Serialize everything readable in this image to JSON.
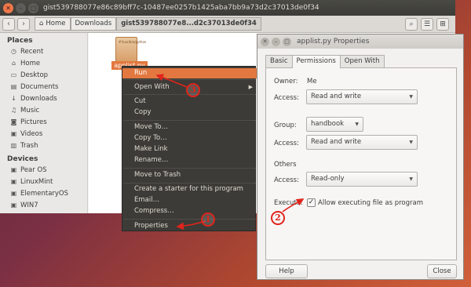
{
  "nautilus": {
    "window_title": "gist539788077e86c89bff7c-10487ee0257b1425aba7bb9a73d2c37013de0f34",
    "breadcrumbs": [
      "Home",
      "Downloads",
      "gist539788077e8...d2c37013de0f34"
    ],
    "sidebar": {
      "places_heading": "Places",
      "places": [
        "Recent",
        "Home",
        "Desktop",
        "Documents",
        "Downloads",
        "Music",
        "Pictures",
        "Videos",
        "Trash"
      ],
      "devices_heading": "Devices",
      "devices": [
        "Pear OS",
        "LinuxMint",
        "ElementaryOS",
        "WIN7"
      ]
    },
    "file": {
      "name": "applist.py",
      "preview": "#!/usr/bin/python"
    }
  },
  "context_menu": {
    "items": [
      "Run",
      "Open With",
      "Cut",
      "Copy",
      "Move To…",
      "Copy To…",
      "Make Link",
      "Rename…",
      "Move to Trash",
      "Create a starter for this program",
      "Email…",
      "Compress…",
      "Properties"
    ],
    "highlighted": "Run"
  },
  "dialog": {
    "title": "applist.py Properties",
    "tabs": [
      "Basic",
      "Permissions",
      "Open With"
    ],
    "active_tab": "Permissions",
    "owner_label": "Owner:",
    "owner_value": "Me",
    "access_label": "Access:",
    "owner_access": "Read and write",
    "group_label": "Group:",
    "group_value": "handbook",
    "group_access": "Read and write",
    "others_label": "Others",
    "others_access": "Read-only",
    "execute_label": "Execute:",
    "execute_text": "Allow executing file as program",
    "execute_checked": true,
    "help_label": "Help",
    "close_label": "Close"
  },
  "annotations": [
    "1",
    "2",
    "3"
  ],
  "colors": {
    "accent": "#e2783f",
    "annotation": "#e0241b"
  }
}
